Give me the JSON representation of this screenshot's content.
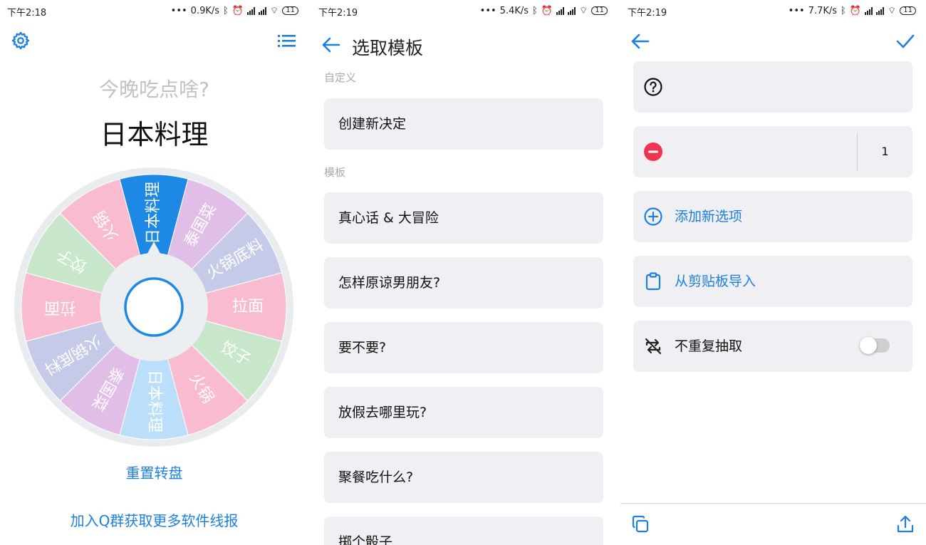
{
  "panel1": {
    "status": {
      "time": "下午2:18",
      "speed": "0.9K/s",
      "battery": "11"
    },
    "question": "今晚吃点啥?",
    "answer": "日本料理",
    "wheel_segments": [
      "日本料理",
      "泰国菜",
      "火锅底料",
      "拉面",
      "饺子",
      "火锅",
      "日本料理",
      "泰国菜",
      "火锅底料",
      "拉面",
      "饺子",
      "火锅"
    ],
    "wheel_colors": [
      "#1e88e5",
      "#e1bee7",
      "#c5cae9",
      "#f8bbd0",
      "#c8e6c9",
      "#f8bbd0",
      "#bbdefb",
      "#e1bee7",
      "#c5cae9",
      "#f8bbd0",
      "#c8e6c9",
      "#f8bbd0"
    ],
    "reset_label": "重置转盘",
    "join_label": "加入Q群获取更多软件线报",
    "icons": {
      "settings": "gear-icon",
      "list": "list-icon"
    }
  },
  "panel2": {
    "status": {
      "time": "下午2:19",
      "speed": "5.4K/s",
      "battery": "11"
    },
    "title": "选取模板",
    "custom_section": "自定义",
    "create_label": "创建新决定",
    "templates_section": "模板",
    "templates": [
      "真心话 & 大冒险",
      "怎样原谅男朋友?",
      "要不要?",
      "放假去哪里玩?",
      "聚餐吃什么?",
      "掷个骰子"
    ],
    "icons": {
      "back": "back-arrow-icon"
    }
  },
  "panel3": {
    "status": {
      "time": "下午2:19",
      "speed": "7.7K/s",
      "battery": "11"
    },
    "option_weight": "1",
    "add_option_label": "添加新选项",
    "import_label": "从剪贴板导入",
    "no_repeat_label": "不重复抽取",
    "no_repeat_enabled": false,
    "icons": {
      "back": "back-arrow-icon",
      "confirm": "check-icon",
      "help": "question-circle-icon",
      "remove": "minus-circle-icon",
      "add": "plus-circle-icon",
      "clipboard": "clipboard-icon",
      "no_repeat": "repeat-off-icon",
      "copy": "copy-icon",
      "share": "share-icon"
    }
  },
  "colors": {
    "accent": "#1d7fe0",
    "card_bg": "#efeff4",
    "remove_red": "#f0344f"
  }
}
